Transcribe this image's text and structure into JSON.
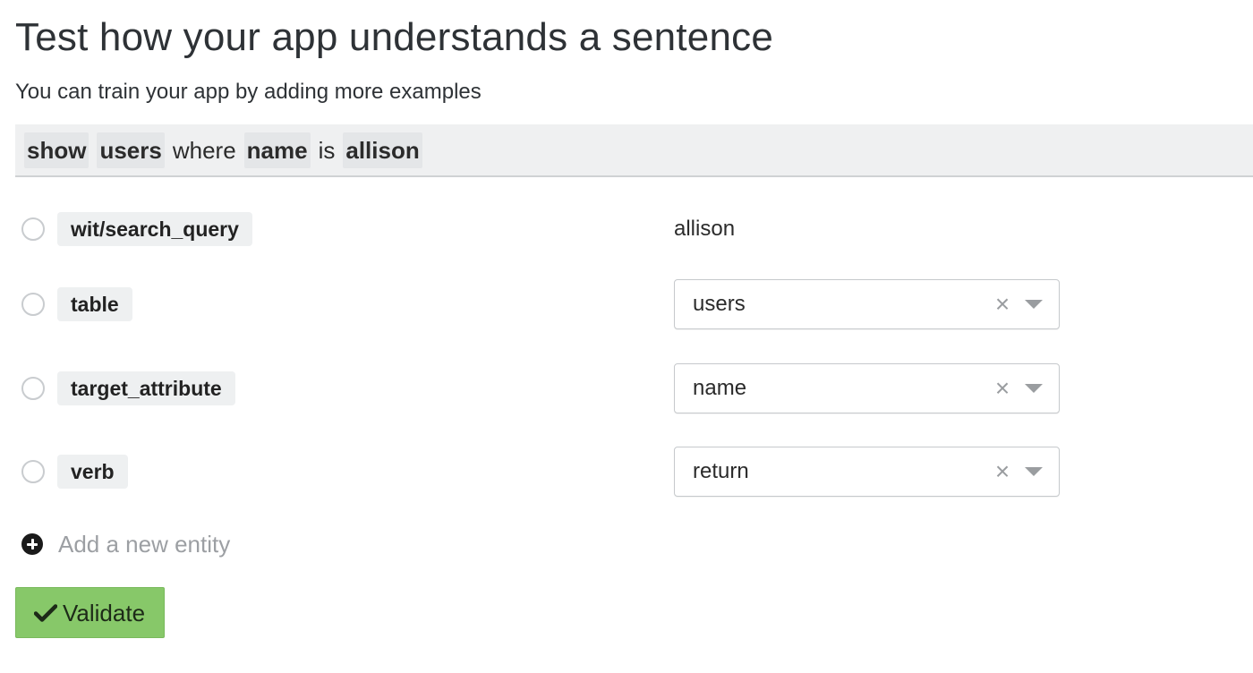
{
  "header": {
    "title": "Test how your app understands a sentence",
    "subtitle": "You can train your app by adding more examples"
  },
  "sentence": {
    "tokens": [
      {
        "text": "show",
        "is_entity": true
      },
      {
        "text": "users",
        "is_entity": true
      },
      {
        "text": "where",
        "is_entity": false
      },
      {
        "text": "name",
        "is_entity": true
      },
      {
        "text": "is",
        "is_entity": false
      },
      {
        "text": "allison",
        "is_entity": true
      }
    ]
  },
  "entities": [
    {
      "name": "wit/search_query",
      "value": "allison",
      "control": "text",
      "selected": false
    },
    {
      "name": "table",
      "value": "users",
      "control": "select",
      "selected": false
    },
    {
      "name": "target_attribute",
      "value": "name",
      "control": "select",
      "selected": false
    },
    {
      "name": "verb",
      "value": "return",
      "control": "select",
      "selected": false
    }
  ],
  "select_glyphs": {
    "clear": "×"
  },
  "add_entity": {
    "label": "Add a new entity",
    "icon": "plus-circle-icon"
  },
  "validate_button": {
    "label": "Validate",
    "icon": "check-icon",
    "color": "#87c869"
  },
  "colors": {
    "sentence_bar_bg": "#eff0f1",
    "chip_bg": "#eef0f1",
    "placeholder_text": "#9c9fa3"
  }
}
